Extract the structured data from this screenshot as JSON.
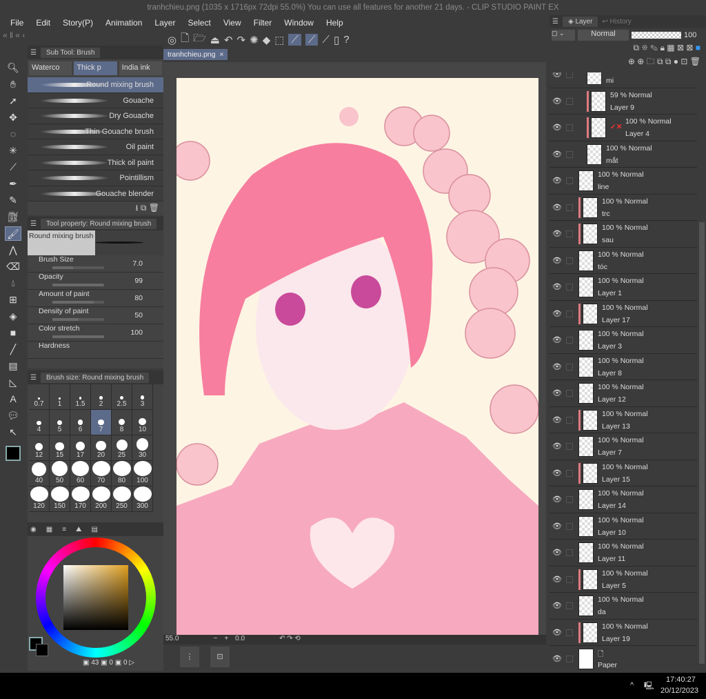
{
  "title": "tranhchieu.png (1035 x 1716px 72dpi 55.0%)  You can use all features for another 21 days. - CLIP STUDIO PAINT EX",
  "menu": [
    "File",
    "Edit",
    "Story(P)",
    "Animation",
    "Layer",
    "Select",
    "View",
    "Filter",
    "Window",
    "Help"
  ],
  "document_tab": "tranhchieu.png",
  "document_tab_close": "×",
  "subtool": {
    "header": "Sub Tool: Brush",
    "tabs": [
      "Waterco",
      "Thick p",
      "India ink"
    ],
    "brushes": [
      "Round mixing brush",
      "Gouache",
      "Dry Gouache",
      "Thin Gouache brush",
      "Oil paint",
      "Thick oil paint",
      "Pointillism",
      "Gouache blender"
    ],
    "selected": 0
  },
  "tool_property": {
    "header": "Tool property: Round mixing brush",
    "preview_label": "Round mixing brush",
    "props": [
      {
        "label": "Brush Size",
        "value": "7.0",
        "fill": 0.4
      },
      {
        "label": "Opacity",
        "value": "99",
        "fill": 0.99
      },
      {
        "label": "Amount of paint",
        "value": "80",
        "fill": 0.8
      },
      {
        "label": "Density of paint",
        "value": "50",
        "fill": 0.5
      },
      {
        "label": "Color stretch",
        "value": "100",
        "fill": 1.0
      }
    ],
    "hardness_label": "Hardness"
  },
  "brush_size": {
    "header": "Brush size: Round mixing brush",
    "sizes": [
      "0.7",
      "1",
      "1.5",
      "2",
      "2.5",
      "3",
      "4",
      "5",
      "6",
      "7",
      "8",
      "10",
      "12",
      "15",
      "17",
      "20",
      "25",
      "30",
      "40",
      "50",
      "60",
      "70",
      "80",
      "100",
      "120",
      "150",
      "170",
      "200",
      "250",
      "300"
    ],
    "selected": "7"
  },
  "color": {
    "main": "#000000",
    "sub": "#000000",
    "hue_color": "#e0a020",
    "values": [
      "43",
      "0",
      "0"
    ]
  },
  "nav": {
    "zoom": "55.0",
    "angle": "0.0"
  },
  "layer_panel": {
    "tabs": [
      "Layer",
      "History"
    ],
    "blend_mode": "Normal",
    "opacity": "100",
    "layers": [
      {
        "mode": "",
        "name": "mi",
        "indent": 1,
        "clip": false
      },
      {
        "mode": "59 % Normal",
        "name": "Layer 9",
        "indent": 1,
        "clip": true
      },
      {
        "mode": "100 % Normal",
        "name": "Layer 4",
        "indent": 1,
        "clip": true,
        "mask": true
      },
      {
        "mode": "100 % Normal",
        "name": "mắt",
        "indent": 1,
        "clip": false
      },
      {
        "mode": "100 % Normal",
        "name": "line",
        "indent": 0,
        "clip": false
      },
      {
        "mode": "100 % Normal",
        "name": "trc",
        "indent": 0,
        "clip": true
      },
      {
        "mode": "100 % Normal",
        "name": "sau",
        "indent": 0,
        "clip": true
      },
      {
        "mode": "100 % Normal",
        "name": "tóc",
        "indent": 0,
        "clip": false
      },
      {
        "mode": "100 % Normal",
        "name": "Layer 1",
        "indent": 0,
        "clip": false
      },
      {
        "mode": "100 % Normal",
        "name": "Layer 17",
        "indent": 0,
        "clip": true
      },
      {
        "mode": "100 % Normal",
        "name": "Layer 3",
        "indent": 0,
        "clip": false
      },
      {
        "mode": "100 % Normal",
        "name": "Layer 8",
        "indent": 0,
        "clip": false
      },
      {
        "mode": "100 % Normal",
        "name": "Layer 12",
        "indent": 0,
        "clip": false
      },
      {
        "mode": "100 % Normal",
        "name": "Layer 13",
        "indent": 0,
        "clip": true
      },
      {
        "mode": "100 % Normal",
        "name": "Layer 7",
        "indent": 0,
        "clip": false
      },
      {
        "mode": "100 % Normal",
        "name": "Layer 15",
        "indent": 0,
        "clip": true
      },
      {
        "mode": "100 % Normal",
        "name": "Layer 14",
        "indent": 0,
        "clip": false
      },
      {
        "mode": "100 % Normal",
        "name": "Layer 10",
        "indent": 0,
        "clip": false
      },
      {
        "mode": "100 % Normal",
        "name": "Layer 11",
        "indent": 0,
        "clip": false
      },
      {
        "mode": "100 % Normal",
        "name": "Layer 5",
        "indent": 0,
        "clip": true
      },
      {
        "mode": "100 % Normal",
        "name": "da",
        "indent": 0,
        "clip": false
      },
      {
        "mode": "100 % Normal",
        "name": "Layer 19",
        "indent": 0,
        "clip": true
      },
      {
        "mode": "",
        "name": "Paper",
        "indent": 0,
        "clip": false,
        "paper": true
      }
    ]
  },
  "taskbar": {
    "time": "17:40:27",
    "date": "20/12/2023"
  }
}
